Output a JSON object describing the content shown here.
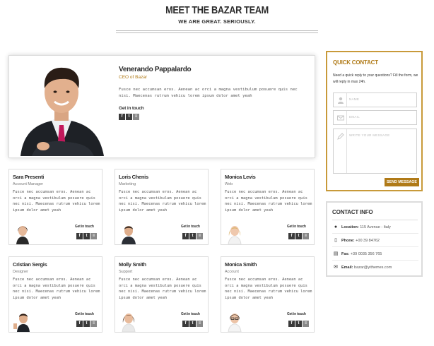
{
  "header": {
    "title": "MEET THE BAZAR TEAM",
    "subtitle": "WE ARE GREAT. SERIOUSLY."
  },
  "featured": {
    "name": "Venerando Pappalardo",
    "role": "CEO of Bazar",
    "description": "Fusce nec accumsan eros. Aenean ac orci a magna vestibulum posuere quis nec nisi. Maecenas rutrum vehicu lorem ipsum dolor amet yeah",
    "get_in_touch": "Get in touch"
  },
  "members": [
    {
      "name": "Sara Presenti",
      "role": "Account Manager",
      "description": "Fusce nec accumsan eros. Aenean ac orci a magna vestibulum posuere quis nec nisi. Maecenas rutrum vehicu lorem ipsum dolor amet yeah",
      "get_in_touch": "Get in touch"
    },
    {
      "name": "Loris Chenis",
      "role": "Marketing",
      "description": "Fusce nec accumsan eros. Aenean ac orci a magna vestibulum posuere quis nec nisi. Maecenas rutrum vehicu lorem ipsum dolor amet yeah",
      "get_in_touch": "Get in touch"
    },
    {
      "name": "Monica Levis",
      "role": "Web",
      "description": "Fusce nec accumsan eros. Aenean ac orci a magna vestibulum posuere quis nec nisi. Maecenas rutrum vehicu lorem ipsum dolor amet yeah",
      "get_in_touch": "Get in touch"
    },
    {
      "name": "Cristian Sergis",
      "role": "Designer",
      "description": "Fusce nec accumsan eros. Aenean ac orci a magna vestibulum posuere quis nec nisi. Maecenas rutrum vehicu lorem ipsum dolor amet yeah",
      "get_in_touch": "Get in touch"
    },
    {
      "name": "Molly Smith",
      "role": "Support",
      "description": "Fusce nec accumsan eros. Aenean ac orci a magna vestibulum posuere quis nec nisi. Maecenas rutrum vehicu lorem ipsum dolor amet yeah",
      "get_in_touch": "Get in touch"
    },
    {
      "name": "Monica Smith",
      "role": "Account",
      "description": "Fusce nec accumsan eros. Aenean ac orci a magna vestibulum posuere quis nec nisi. Maecenas rutrum vehicu lorem ipsum dolor amet yeah",
      "get_in_touch": "Get in touch"
    }
  ],
  "social_icons": [
    "facebook-icon",
    "twitter-icon",
    "rss-icon"
  ],
  "quick_contact": {
    "title": "QUICK CONTACT",
    "description": "Need a quick reply to your questions? Fill the form, we will reply in max 24h.",
    "name_placeholder": "NAME",
    "email_placeholder": "EMAIL",
    "message_placeholder": "WRITE YOUR MESSAGE",
    "send_label": "SEND MESSAGE"
  },
  "contact_info": {
    "title": "CONTACT INFO",
    "location_label": "Location:",
    "location_value": "115 Avenue - Italy",
    "phone_label": "Phone:",
    "phone_value": "+00 39 84762",
    "fax_label": "Fax:",
    "fax_value": "+39 0035 356 765",
    "email_label": "Email:",
    "email_value": "bazar@yithemes.com"
  },
  "colors": {
    "accent": "#b07a17",
    "border_gold": "#c89a3a",
    "dark": "#3a3a3a"
  }
}
